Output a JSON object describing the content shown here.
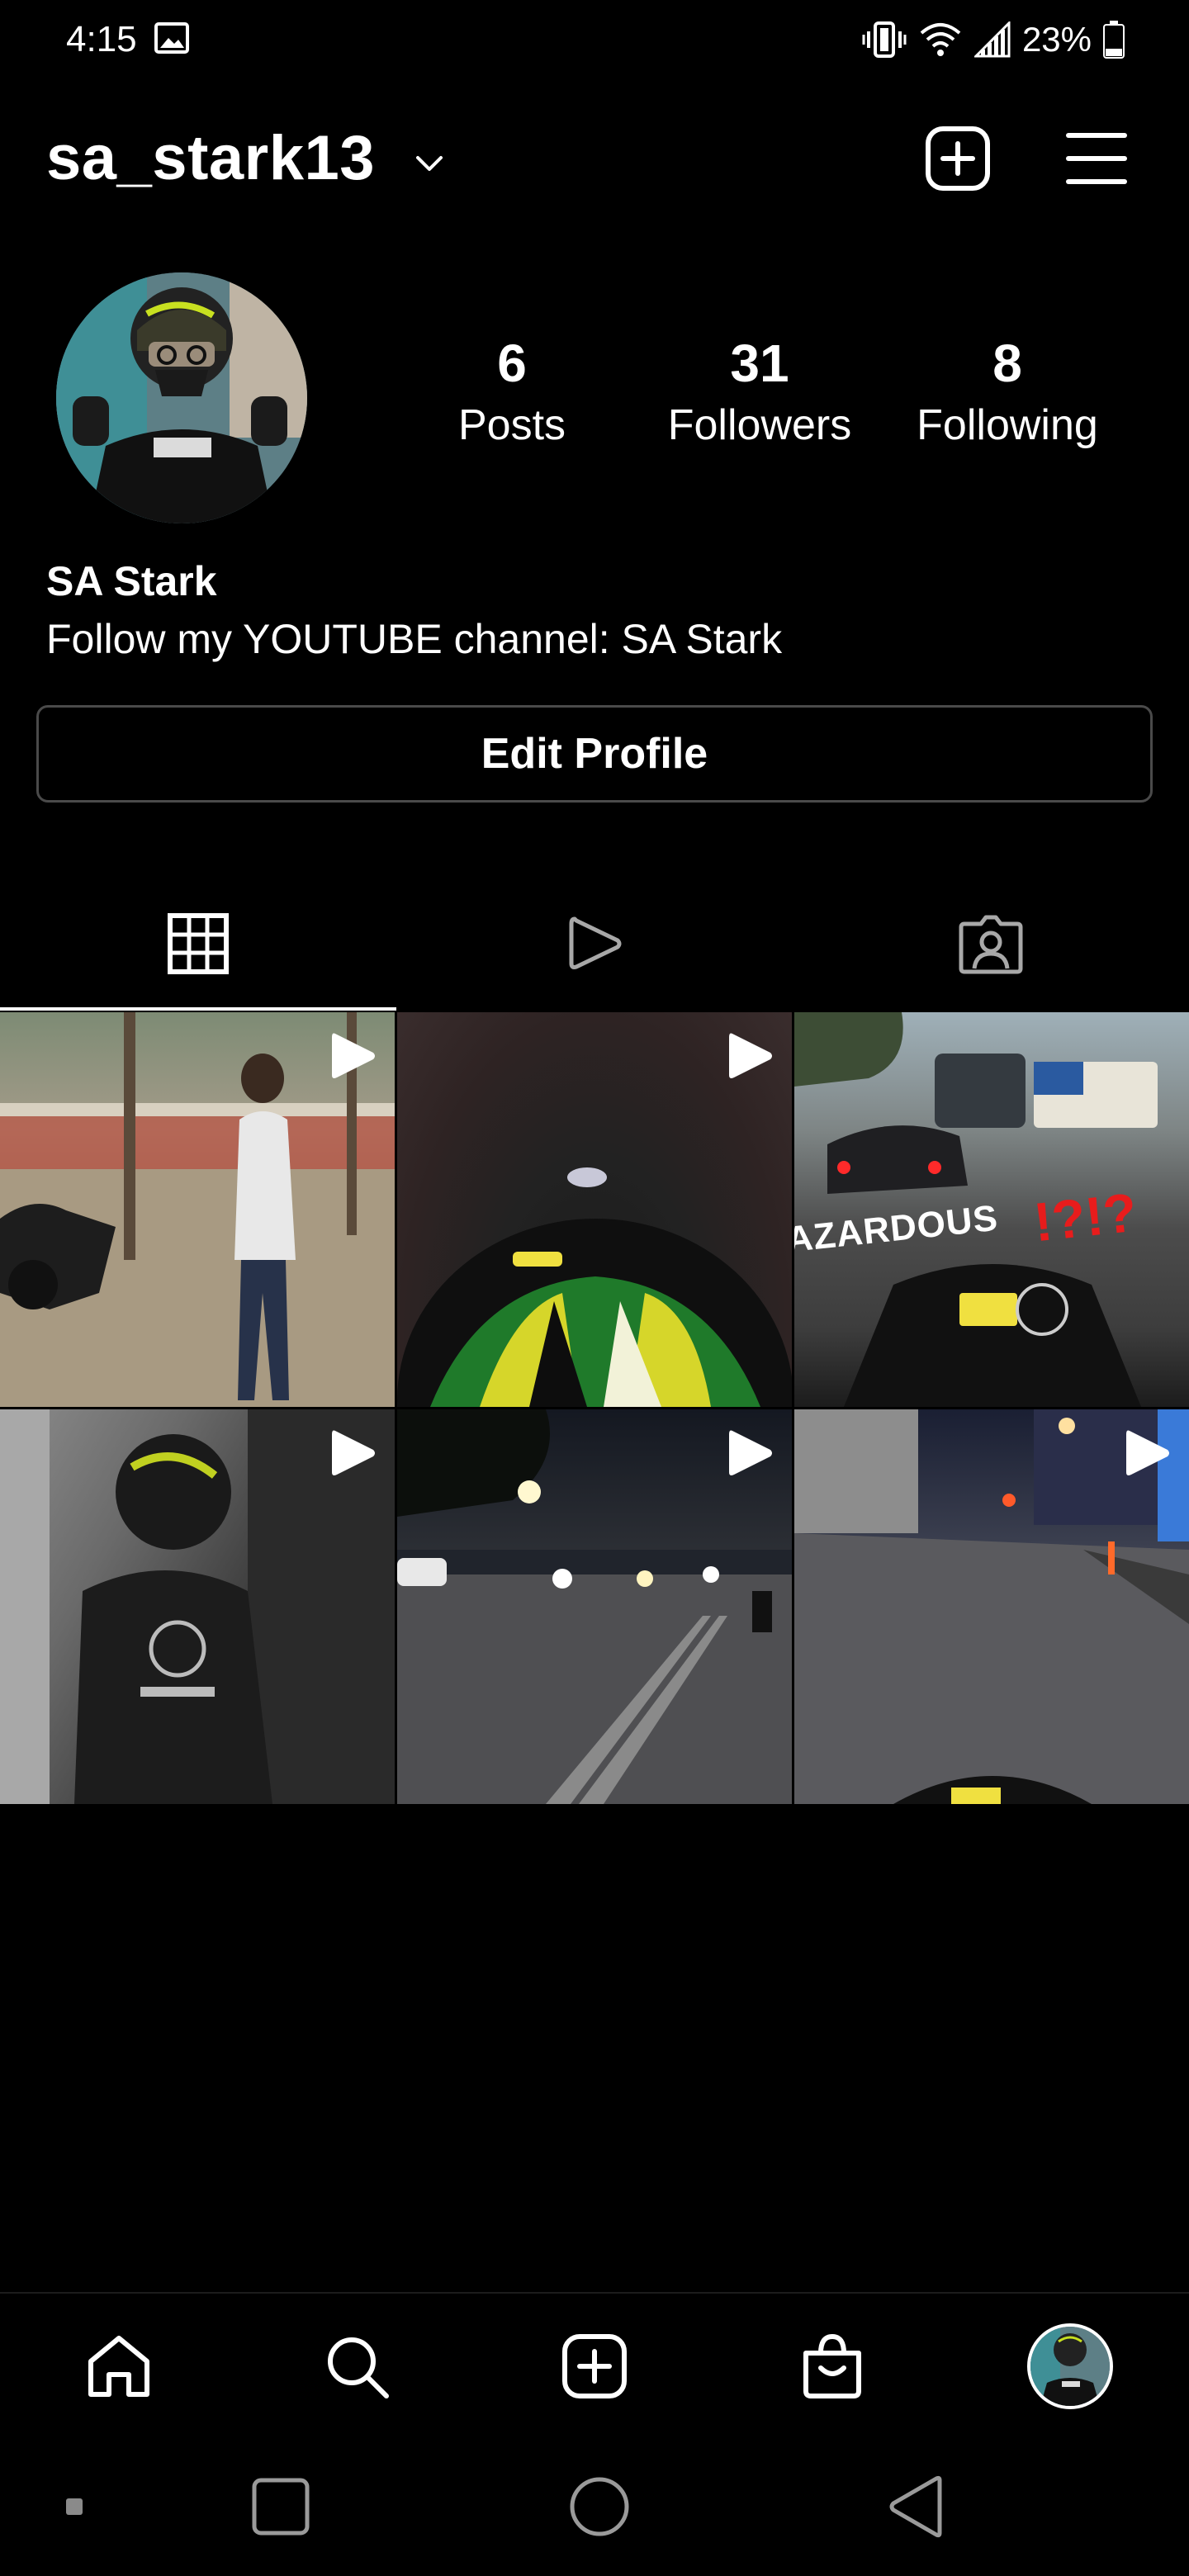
{
  "status_bar": {
    "time": "4:15",
    "battery": "23%",
    "icons": [
      "gallery-icon",
      "vibrate-icon",
      "wifi-icon",
      "signal-icon",
      "battery-icon"
    ]
  },
  "header": {
    "username": "sa_stark13",
    "icons": [
      "chevron-down-icon",
      "new-post-icon",
      "hamburger-menu-icon"
    ]
  },
  "profile": {
    "stats": [
      {
        "value": "6",
        "label": "Posts"
      },
      {
        "value": "31",
        "label": "Followers"
      },
      {
        "value": "8",
        "label": "Following"
      }
    ],
    "full_name": "SA Stark",
    "bio": "Follow my YOUTUBE channel: SA Stark",
    "edit_button": "Edit Profile"
  },
  "tabs": [
    {
      "icon": "grid-icon",
      "selected": true
    },
    {
      "icon": "reels-play-icon",
      "selected": false
    },
    {
      "icon": "tagged-person-icon",
      "selected": false
    }
  ],
  "posts": [
    {
      "type": "video"
    },
    {
      "type": "video"
    },
    {
      "type": "image",
      "overlay_text": "AZARDOUS",
      "overlay_marks": "!?!?"
    },
    {
      "type": "video"
    },
    {
      "type": "video"
    },
    {
      "type": "video"
    }
  ],
  "bottom_nav": [
    "home-icon",
    "search-icon",
    "create-icon",
    "shop-icon",
    "profile-avatar"
  ],
  "system_nav": [
    "recents-icon",
    "home-circle-icon",
    "back-icon"
  ],
  "colors": {
    "background": "#000000",
    "text": "#ffffff",
    "button_border": "#4a4a4a",
    "inactive_icon": "#a8a8a8",
    "hazard_red": "#e81c1c"
  }
}
